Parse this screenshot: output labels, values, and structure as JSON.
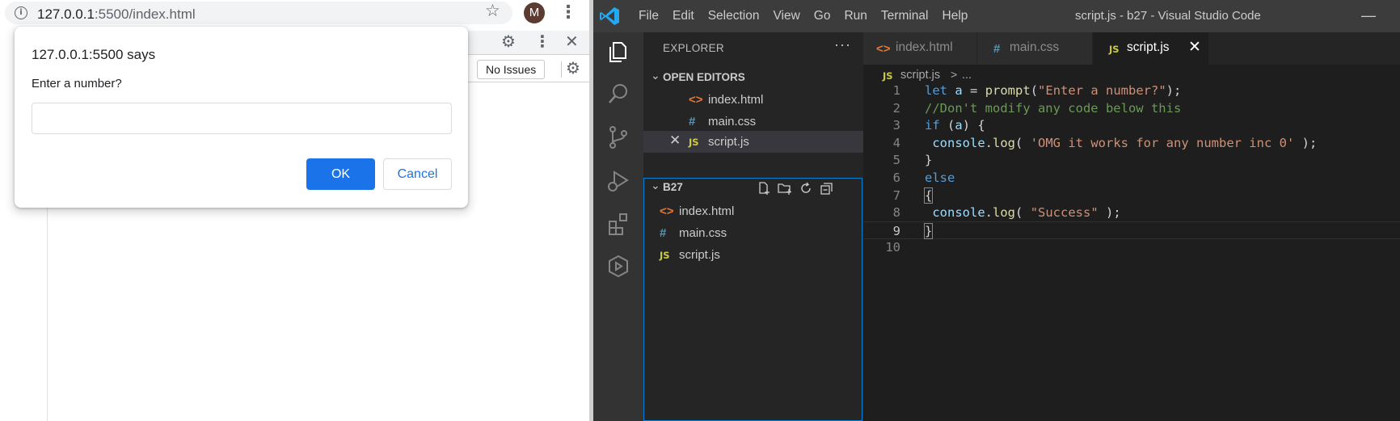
{
  "chrome": {
    "url_host": "127.0.0.1",
    "url_rest": ":5500/index.html",
    "avatar_initial": "M",
    "devtools_issues_label": "No Issues"
  },
  "dialog": {
    "title": "127.0.0.1:5500 says",
    "message": "Enter a number?",
    "input_value": "",
    "ok_label": "OK",
    "cancel_label": "Cancel"
  },
  "vscode": {
    "menu": [
      "File",
      "Edit",
      "Selection",
      "View",
      "Go",
      "Run",
      "Terminal",
      "Help"
    ],
    "window_title": "script.js - b27 - Visual Studio Code",
    "explorer_title": "EXPLORER",
    "explorer_more": "···",
    "open_editors_label": "OPEN EDITORS",
    "open_editors": [
      {
        "icon": "<>",
        "name": "index.html"
      },
      {
        "icon": "#",
        "name": "main.css"
      },
      {
        "icon": "JS",
        "name": "script.js"
      }
    ],
    "folder_label": "B27",
    "folder_files": [
      {
        "icon": "<>",
        "name": "index.html"
      },
      {
        "icon": "#",
        "name": "main.css"
      },
      {
        "icon": "JS",
        "name": "script.js"
      }
    ],
    "tabs": [
      {
        "icon": "<>",
        "name": "index.html"
      },
      {
        "icon": "#",
        "name": "main.css"
      },
      {
        "icon": "JS",
        "name": "script.js"
      }
    ],
    "breadcrumb": {
      "icon": "JS",
      "file": "script.js",
      "sep": ">",
      "rest": "..."
    },
    "code_lines": [
      {
        "n": "1",
        "parts": [
          [
            "kw",
            "let"
          ],
          [
            "",
            " "
          ],
          [
            "vr",
            "a"
          ],
          [
            "",
            " = "
          ],
          [
            "fn",
            "prompt"
          ],
          [
            "",
            "("
          ],
          [
            "str",
            "\"Enter a number?\""
          ],
          [
            "",
            ");"
          ]
        ]
      },
      {
        "n": "2",
        "parts": [
          [
            "cm",
            "//Don't modify any code below this"
          ]
        ]
      },
      {
        "n": "3",
        "parts": [
          [
            "kw",
            "if"
          ],
          [
            "",
            " ("
          ],
          [
            "vr",
            "a"
          ],
          [
            "",
            ") {"
          ]
        ]
      },
      {
        "n": "4",
        "parts": [
          [
            "",
            " "
          ],
          [
            "vr",
            "console"
          ],
          [
            "",
            "."
          ],
          [
            "fn",
            "log"
          ],
          [
            "",
            "( "
          ],
          [
            "str",
            "'OMG it works for any number inc 0'"
          ],
          [
            "",
            " );"
          ]
        ]
      },
      {
        "n": "5",
        "parts": [
          [
            "",
            "}"
          ]
        ]
      },
      {
        "n": "6",
        "parts": [
          [
            "kw",
            "else"
          ]
        ]
      },
      {
        "n": "7",
        "parts": [
          [
            "bm",
            "{"
          ]
        ]
      },
      {
        "n": "8",
        "parts": [
          [
            "",
            " "
          ],
          [
            "vr",
            "console"
          ],
          [
            "",
            "."
          ],
          [
            "fn",
            "log"
          ],
          [
            "",
            "( "
          ],
          [
            "str",
            "\"Success\""
          ],
          [
            "",
            " );"
          ]
        ]
      },
      {
        "n": "9",
        "parts": [
          [
            "bm",
            "}"
          ]
        ]
      },
      {
        "n": "10",
        "parts": []
      }
    ]
  },
  "colors": {
    "chrome_accent": "#1a73e8",
    "vscode_titlebar": "#3c3c3c",
    "vscode_editor_bg": "#1e1e1e",
    "vscode_sidebar_bg": "#252526",
    "vscode_focus_border": "#007fd4"
  }
}
